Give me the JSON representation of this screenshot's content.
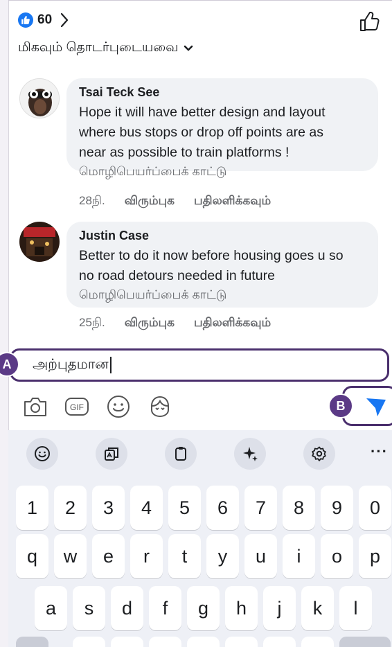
{
  "reactions": {
    "count": "60",
    "chevron": "›"
  },
  "sort": {
    "label": "மிகவும் தொடர்புடையவை"
  },
  "comments": [
    {
      "name": "Tsai Teck See",
      "lines": [
        "Hope it will have better design and layout",
        "where bus stops or drop off points are as",
        "near as possible to train platforms !"
      ],
      "translate": "மொழிபெயர்ப்பைக் காட்டு",
      "time": "28நி.",
      "like": "விரும்புக",
      "reply": "பதிலளிக்கவும்"
    },
    {
      "name": "Justin Case",
      "lines": [
        "Better to do it now before housing goes u so",
        "no road detours needed in future"
      ],
      "translate": "மொழிபெயர்ப்பைக் காட்டு",
      "time": "25நி.",
      "like": "விரும்புக",
      "reply": "பதிலளிக்கவும்"
    }
  ],
  "composer": {
    "value": "அற்புதமான",
    "marker_a": "A",
    "marker_b": "B"
  },
  "toolbar_icons": [
    "camera-icon",
    "gif-icon",
    "emoji-icon",
    "avatar-sticker-icon",
    "send-icon"
  ],
  "keyboard": {
    "numbers": [
      "1",
      "2",
      "3",
      "4",
      "5",
      "6",
      "7",
      "8",
      "9",
      "0"
    ],
    "row1": [
      "q",
      "w",
      "e",
      "r",
      "t",
      "y",
      "u",
      "i",
      "o",
      "p"
    ],
    "row2": [
      "a",
      "s",
      "d",
      "f",
      "g",
      "h",
      "j",
      "k",
      "l"
    ],
    "tools": [
      "emoji-icon",
      "sticker-icon",
      "clipboard-icon",
      "sparkle-icon",
      "settings-icon"
    ],
    "more": "···"
  },
  "colors": {
    "accent": "#1877f2",
    "marker": "#5b3a86",
    "highlight_border": "#4a2f6d"
  }
}
